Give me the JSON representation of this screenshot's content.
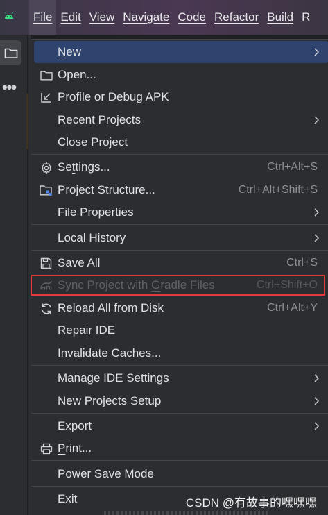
{
  "menubar": {
    "items": [
      "File",
      "Edit",
      "View",
      "Navigate",
      "Code",
      "Refactor",
      "Build",
      "R"
    ],
    "active": "File"
  },
  "file_menu": {
    "new": {
      "label": "New",
      "mnemonic": "N",
      "rest": "ew"
    },
    "open": {
      "label": "Open..."
    },
    "profile_debug": {
      "label": "Profile or Debug APK"
    },
    "recent_projects": {
      "pre": "",
      "mnemonic": "R",
      "rest": "ecent Projects"
    },
    "close_project": {
      "label": "Close Project"
    },
    "settings": {
      "pre": "Se",
      "mnemonic": "t",
      "rest": "tings...",
      "shortcut": "Ctrl+Alt+S"
    },
    "project_structure": {
      "label": "Project Structure...",
      "shortcut": "Ctrl+Alt+Shift+S"
    },
    "file_properties": {
      "label": "File Properties"
    },
    "local_history": {
      "pre": "Local ",
      "mnemonic": "H",
      "rest": "istory"
    },
    "save_all": {
      "pre": "",
      "mnemonic": "S",
      "rest": "ave All",
      "shortcut": "Ctrl+S"
    },
    "sync_gradle": {
      "pre": "Sync Project with ",
      "mnemonic": "G",
      "rest": "radle Files",
      "shortcut": "Ctrl+Shift+O"
    },
    "reload_disk": {
      "label": "Reload All from Disk",
      "shortcut": "Ctrl+Alt+Y"
    },
    "repair_ide": {
      "label": "Repair IDE"
    },
    "invalidate_caches": {
      "label": "Invalidate Caches..."
    },
    "manage_ide_settings": {
      "label": "Manage IDE Settings"
    },
    "new_projects_setup": {
      "label": "New Projects Setup"
    },
    "export": {
      "label": "Export"
    },
    "print": {
      "pre": "",
      "mnemonic": "P",
      "rest": "rint..."
    },
    "power_save_mode": {
      "label": "Power Save Mode"
    },
    "exit": {
      "pre": "E",
      "mnemonic": "x",
      "rest": "it"
    }
  },
  "watermark": "CSDN @有故事的嘿嘿嘿",
  "colors": {
    "menu_bg": "#2b2d30",
    "highlight": "#2e436e",
    "red_outline": "#e5383b",
    "android_green": "#3ddc84"
  }
}
